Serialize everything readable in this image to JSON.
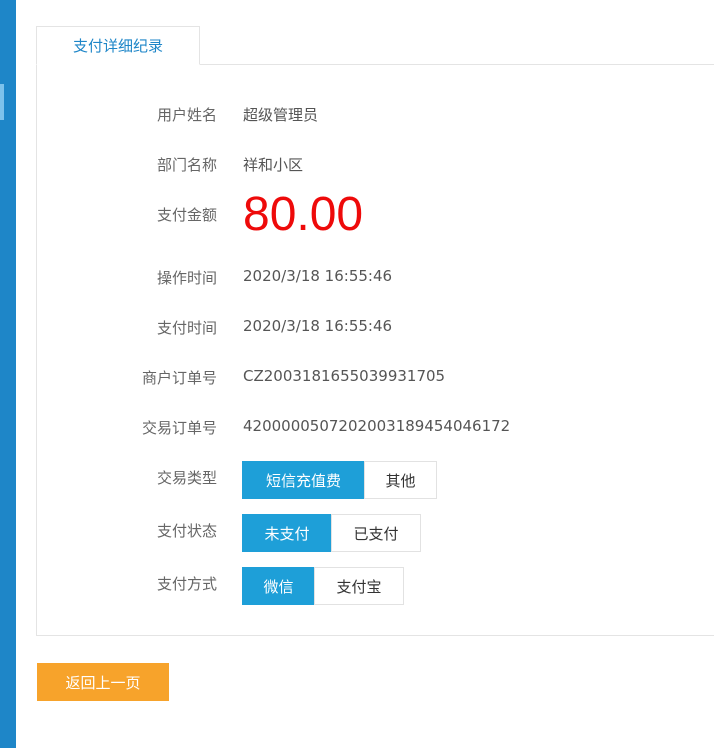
{
  "tab": {
    "label": "支付详细纪录"
  },
  "fields": {
    "user_name": {
      "label": "用户姓名",
      "value": "超级管理员"
    },
    "department": {
      "label": "部门名称",
      "value": "祥和小区"
    },
    "amount": {
      "label": "支付金额",
      "value": "80.00"
    },
    "operate_time": {
      "label": "操作时间",
      "value": "2020/3/18 16:55:46"
    },
    "pay_time": {
      "label": "支付时间",
      "value": "2020/3/18 16:55:46"
    },
    "merchant_order": {
      "label": "商户订单号",
      "value": "CZ2003181655039931705"
    },
    "trade_order": {
      "label": "交易订单号",
      "value": "4200000507202003189454046172"
    }
  },
  "trade_type": {
    "label": "交易类型",
    "options": [
      "短信充值费",
      "其他"
    ],
    "selected": "短信充值费"
  },
  "pay_status": {
    "label": "支付状态",
    "options": [
      "未支付",
      "已支付"
    ],
    "selected": "未支付"
  },
  "pay_method": {
    "label": "支付方式",
    "options": [
      "微信",
      "支付宝"
    ],
    "selected": "微信"
  },
  "back_button": {
    "label": "返回上一页"
  },
  "colors": {
    "accent": "#1e9fd8",
    "amount": "#ee0a0a",
    "back_button": "#f7a32b",
    "rail": "#1e86c8"
  }
}
